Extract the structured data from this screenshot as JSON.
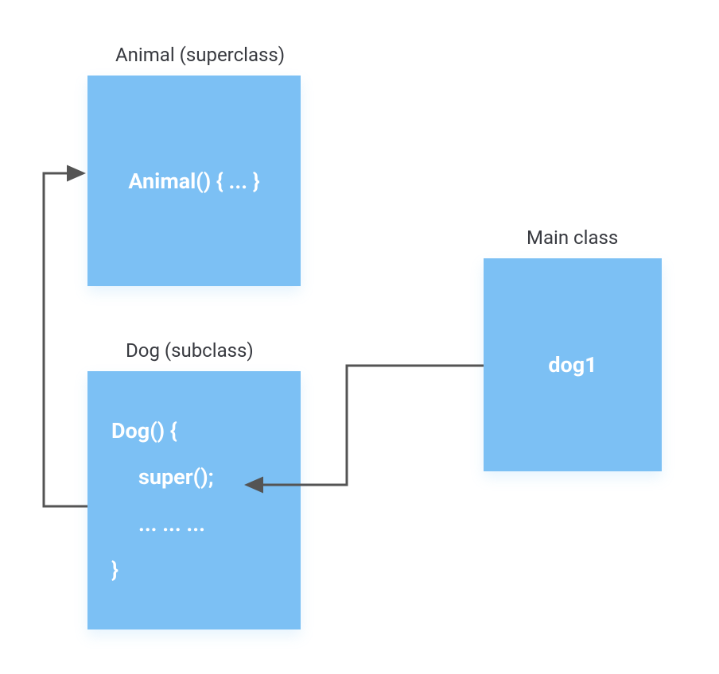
{
  "boxes": {
    "animal": {
      "title": "Animal (superclass)",
      "content": "Animal() { ... }"
    },
    "dog": {
      "title": "Dog (subclass)",
      "line1": "Dog() {",
      "line2": "super();",
      "line3": "... ... ...",
      "line4": "}"
    },
    "main": {
      "title": "Main class",
      "content": "dog1"
    }
  },
  "colors": {
    "box_fill": "#7cc0f4",
    "text_on_box": "#ffffff",
    "label": "#383a40",
    "arrow": "#545454"
  },
  "arrows": [
    {
      "from": "main-box (dog1)",
      "to": "dog-box (super())",
      "path_hint": "left from dog1, down, left into super()"
    },
    {
      "from": "dog-box (super())",
      "to": "animal-box (Animal())",
      "path_hint": "left out of super(), up, right into Animal()"
    }
  ]
}
